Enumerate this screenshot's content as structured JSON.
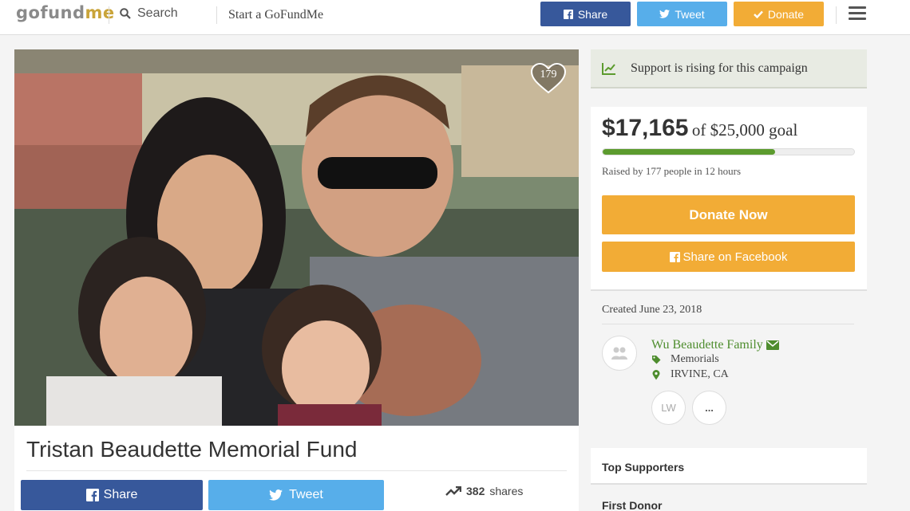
{
  "header": {
    "logo_part1": "gofund",
    "logo_part2": "me",
    "search_label": "Search",
    "start_label": "Start a GoFundMe",
    "share_label": "Share",
    "tweet_label": "Tweet",
    "donate_label": "Donate"
  },
  "photo": {
    "heart_count": "179"
  },
  "campaign": {
    "title": "Tristan Beaudette Memorial Fund",
    "share_label": "Share",
    "tweet_label": "Tweet",
    "shares_count": "382",
    "shares_word": "shares"
  },
  "sidebar": {
    "rising_text": "Support is rising for this campaign",
    "amount": "$17,165",
    "goal_text": "of $25,000 goal",
    "progress_fraction": 0.6866,
    "raised_text": "Raised by 177 people in 12 hours",
    "donate_now_label": "Donate Now",
    "share_fb_label": "Share on Facebook",
    "created_text": "Created June 23, 2018",
    "organizer_name": "Wu Beaudette Family",
    "category": "Memorials",
    "location": "IRVINE, CA",
    "team_initials": "LW",
    "more_label": "...",
    "top_supporters_label": "Top Supporters",
    "first_donor_label": "First Donor"
  },
  "colors": {
    "facebook": "#37589b",
    "twitter": "#57aeea",
    "donate": "#f2ac36",
    "progress": "#5c9b2e",
    "organizer_link": "#4e8d2e"
  },
  "icons": [
    "search-icon",
    "facebook-icon",
    "twitter-icon",
    "check-icon",
    "menu-icon",
    "heart-icon",
    "trending-up-icon",
    "tag-icon",
    "map-pin-icon",
    "envelope-icon",
    "people-icon"
  ]
}
